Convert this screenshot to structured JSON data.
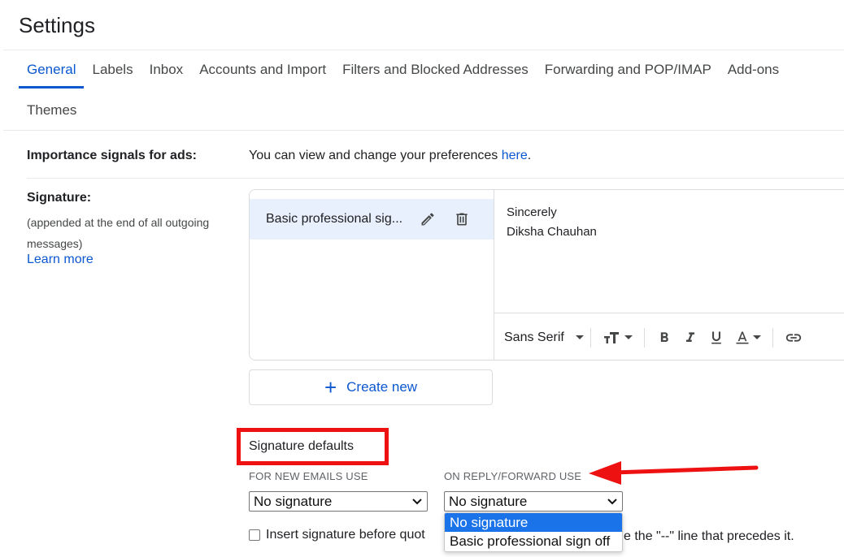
{
  "page": {
    "title": "Settings"
  },
  "tabs": {
    "row1": [
      "General",
      "Labels",
      "Inbox",
      "Accounts and Import",
      "Filters and Blocked Addresses",
      "Forwarding and POP/IMAP",
      "Add-ons"
    ],
    "row2": [
      "Themes"
    ],
    "active": "General"
  },
  "importance": {
    "label": "Importance signals for ads:",
    "text": "You can view and change your preferences ",
    "link": "here",
    "period": "."
  },
  "signature": {
    "label": "Signature:",
    "sub": "(appended at the end of all outgoing messages)",
    "learn_more": "Learn more",
    "items": [
      {
        "name": "Basic professional sig..."
      }
    ],
    "body_lines": [
      "Sincerely",
      "Diksha Chauhan"
    ],
    "toolbar": {
      "font": "Sans Serif"
    },
    "create_new": "Create new"
  },
  "defaults": {
    "title": "Signature defaults",
    "new_label": "FOR NEW EMAILS USE",
    "reply_label": "ON REPLY/FORWARD USE",
    "new_value": "No signature",
    "reply_value": "No signature",
    "reply_options": [
      "No signature",
      "Basic professional sign off"
    ],
    "insert_text_left": "Insert signature before quot",
    "insert_text_right": "e the \"--\" line that precedes it."
  },
  "annotation": {
    "box_color": "#ee1111",
    "arrow_color": "#ee1111"
  },
  "colors": {
    "accent": "#0b57d0",
    "selected_option": "#1a73e8",
    "signature_item_bg": "#e8f0fe"
  }
}
